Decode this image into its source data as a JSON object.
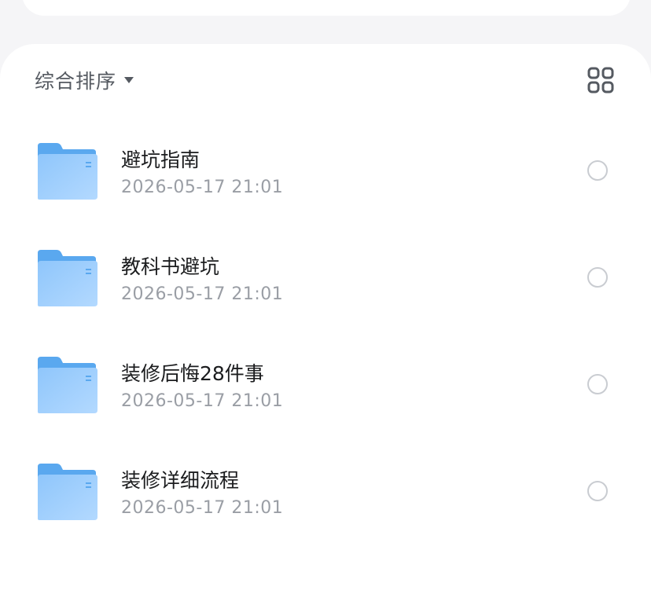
{
  "sort": {
    "label": "综合排序",
    "caret_icon": "caret-down-icon",
    "view_toggle_icon": "grid-view-icon"
  },
  "colors": {
    "folder_back": "#5aa8ef",
    "folder_front": "#8fc6fb",
    "folder_front_light": "#b3d9ff",
    "text_primary": "#1b1c1e",
    "text_secondary": "#9a9ea5",
    "radio_border": "#c9ccd1"
  },
  "folders": [
    {
      "name": "避坑指南",
      "date": "2026-05-17 21:01",
      "icon": "folder-icon"
    },
    {
      "name": "教科书避坑",
      "date": "2026-05-17 21:01",
      "icon": "folder-icon"
    },
    {
      "name": "装修后悔28件事",
      "date": "2026-05-17 21:01",
      "icon": "folder-icon"
    },
    {
      "name": "装修详细流程",
      "date": "2026-05-17 21:01",
      "icon": "folder-icon"
    }
  ]
}
